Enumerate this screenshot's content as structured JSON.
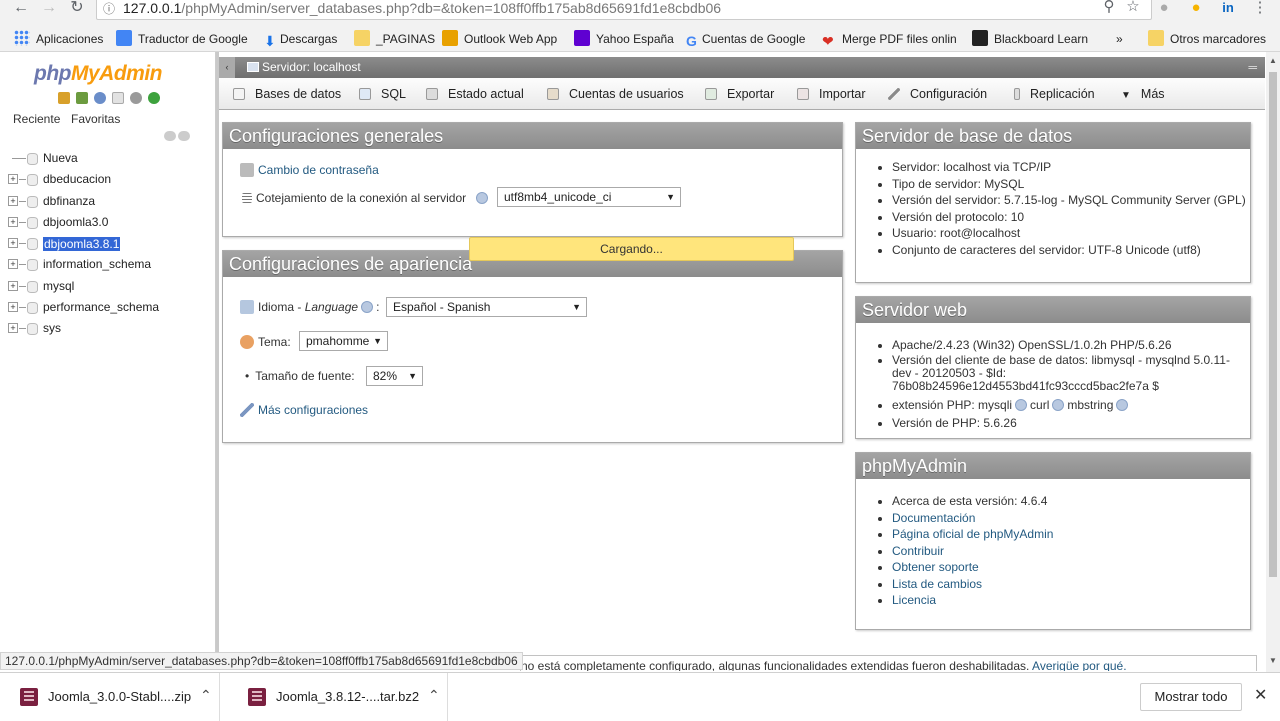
{
  "browser": {
    "url_host": "127.0.0.1",
    "url_path": "/phpMyAdmin/server_databases.php?db=&token=108ff0ffb175ab8d65691fd1e8cbdb06",
    "bookmarks": [
      {
        "label": "Aplicaciones",
        "color": "#4285f4"
      },
      {
        "label": "Traductor de Google",
        "color": "#4285f4"
      },
      {
        "label": "Descargas",
        "color": "#1a73e8"
      },
      {
        "label": "_PAGINAS",
        "color": "#f6d365"
      },
      {
        "label": "Outlook Web App",
        "color": "#e8a100"
      },
      {
        "label": "Yahoo España",
        "color": "#5f01d1"
      },
      {
        "label": "Cuentas de Google",
        "color": "#ffffff"
      },
      {
        "label": "Merge PDF files onlin",
        "color": "#d93025"
      },
      {
        "label": "Blackboard Learn",
        "color": "#222222"
      },
      {
        "label": "»",
        "color": ""
      },
      {
        "label": "Otros marcadores",
        "color": "#f6d365"
      }
    ]
  },
  "nav": {
    "logo_a": "php",
    "logo_b": "MyAdmin",
    "tab_recent": "Reciente",
    "tab_favorites": "Favoritas",
    "new_label": "Nueva",
    "databases": [
      "dbeducacion",
      "dbfinanza",
      "dbjoomla3.0",
      "dbjoomla3.8.1",
      "information_schema",
      "mysql",
      "performance_schema",
      "sys"
    ]
  },
  "server_bar": {
    "label": "Servidor: localhost"
  },
  "menu": [
    "Bases de datos",
    "SQL",
    "Estado actual",
    "Cuentas de usuarios",
    "Exportar",
    "Importar",
    "Configuración",
    "Replicación",
    "Más"
  ],
  "general": {
    "title": "Configuraciones generales",
    "change_password": "Cambio de contraseña",
    "collation_label": "Cotejamiento de la conexión al servidor",
    "collation_value": "utf8mb4_unicode_ci"
  },
  "appearance": {
    "title": "Configuraciones de apariencia",
    "language_label": "Idioma - ",
    "language_italic": "Language",
    "language_value": "Español - Spanish",
    "theme_label": "Tema:",
    "theme_value": "pmahomme",
    "fontsize_label": "Tamaño de fuente:",
    "fontsize_value": "82%",
    "more_settings": "Más configuraciones"
  },
  "db_server": {
    "title": "Servidor de base de datos",
    "items": [
      "Servidor: localhost via TCP/IP",
      "Tipo de servidor: MySQL",
      "Versión del servidor: 5.7.15-log - MySQL Community Server (GPL)",
      "Versión del protocolo: 10",
      "Usuario: root@localhost",
      "Conjunto de caracteres del servidor: UTF-8 Unicode (utf8)"
    ]
  },
  "web_server": {
    "title": "Servidor web",
    "apache": "Apache/2.4.23 (Win32) OpenSSL/1.0.2h PHP/5.6.26",
    "client_version": "Versión del cliente de base de datos: libmysql - mysqlnd 5.0.11-dev - 20120503 - $Id: 76b08b24596e12d4553bd41fc93cccd5bac2fe7a $",
    "ext_label": "extensión PHP: mysqli",
    "ext_curl": "curl",
    "ext_mbstring": "mbstring",
    "php_version": "Versión de PHP: 5.6.26"
  },
  "pma": {
    "title": "phpMyAdmin",
    "version": "Acerca de esta versión: 4.6.4",
    "links": [
      "Documentación",
      "Página oficial de phpMyAdmin",
      "Contribuir",
      "Obtener soporte",
      "Lista de cambios",
      "Licencia"
    ]
  },
  "loading": "Cargando...",
  "status_url": "127.0.0.1/phpMyAdmin/server_databases.php?db=&token=108ff0ffb175ab8d65691fd1e8cbdb06",
  "notice": {
    "text": "no está completamente configurado, algunas funcionalidades extendidas fueron deshabilitadas.",
    "link": "Averigüe por qué."
  },
  "downloads": {
    "files": [
      "Joomla_3.0.0-Stabl....zip",
      "Joomla_3.8.12-....tar.bz2"
    ],
    "show_all": "Mostrar todo"
  }
}
